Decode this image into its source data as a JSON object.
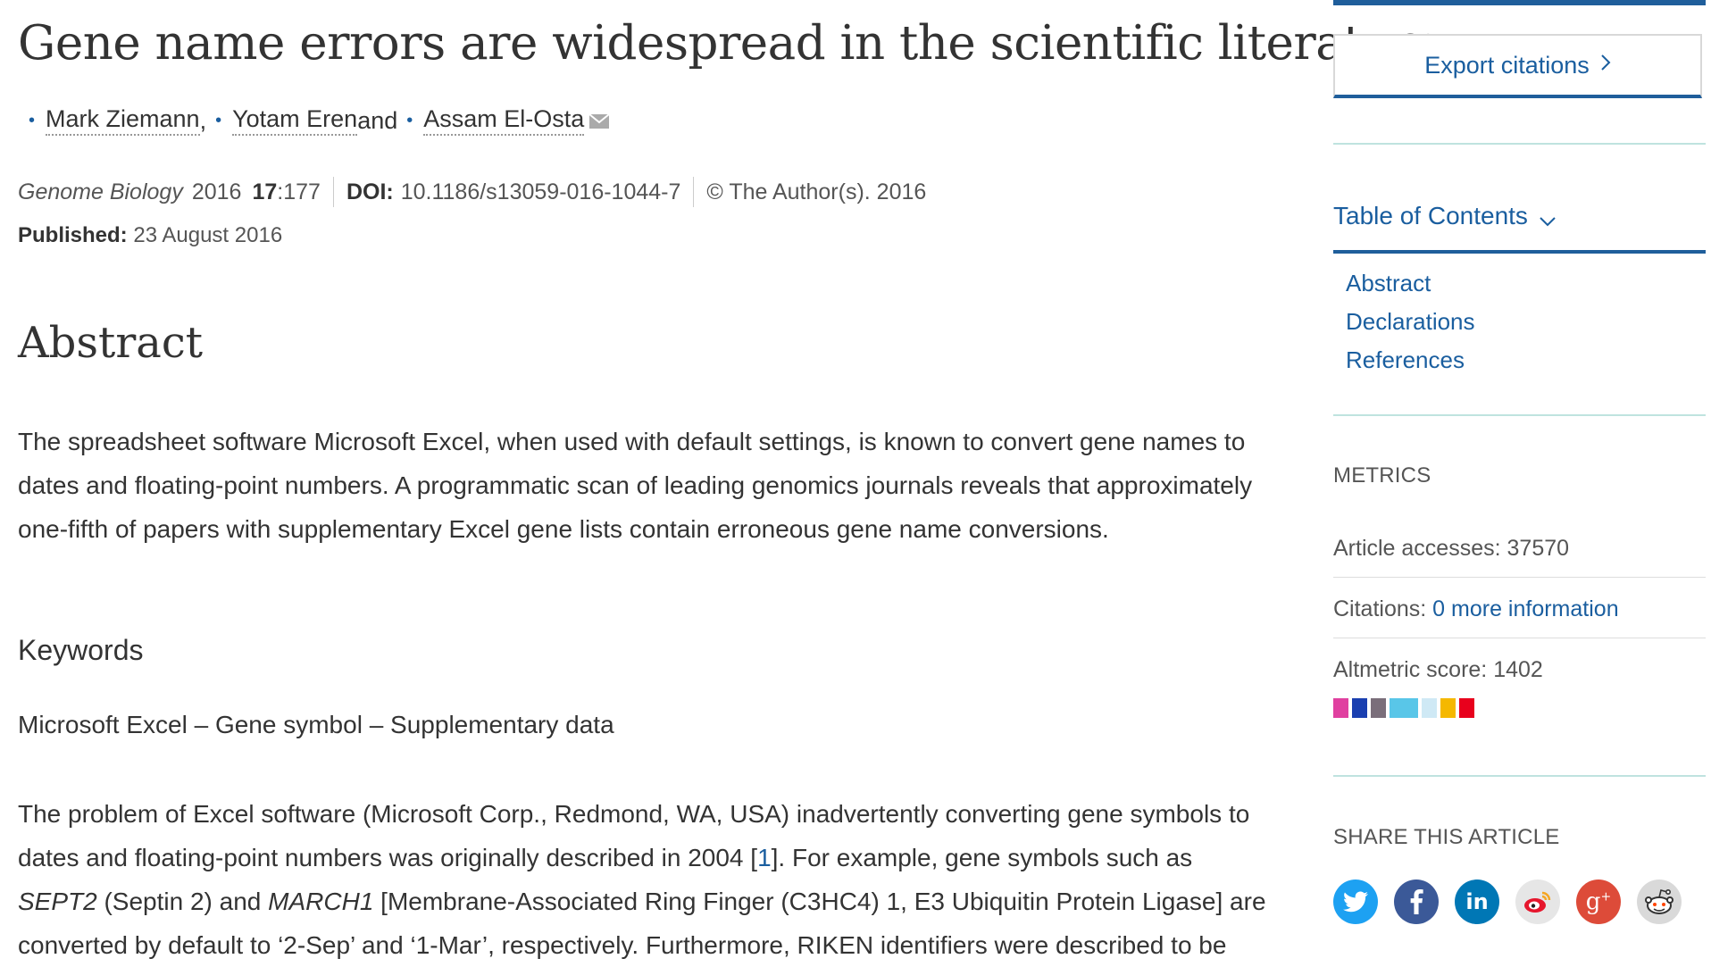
{
  "article": {
    "title": "Gene name errors are widespread in the scientific literature",
    "authors": [
      {
        "name": "Mark Ziemann",
        "sep": ","
      },
      {
        "name": "Yotam Eren",
        "sep": " and"
      },
      {
        "name": "Assam El-Osta",
        "sep": ""
      }
    ],
    "journal": "Genome Biology",
    "year": "2016",
    "volume": "17",
    "article_number": ":177",
    "doi_label": "DOI:",
    "doi": "10.1186/s13059-016-1044-7",
    "copyright": "© The Author(s). 2016",
    "published_label": "Published:",
    "published_date": "23 August 2016"
  },
  "abstract": {
    "heading": "Abstract",
    "text": "The spreadsheet software Microsoft Excel, when used with default settings, is known to convert gene names to dates and floating-point numbers. A programmatic scan of leading genomics journals reveals that approximately one-fifth of papers with supplementary Excel gene lists contain erroneous gene name conversions."
  },
  "keywords": {
    "heading": "Keywords",
    "text": "Microsoft Excel – Gene symbol – Supplementary data"
  },
  "body": {
    "p1_a": "The problem of Excel software (Microsoft Corp., Redmond, WA, USA) inadvertently converting gene symbols to dates and floating-point numbers was originally described in 2004 [",
    "p1_ref": "1",
    "p1_b": "]. For example, gene symbols such as ",
    "p1_gene1": "SEPT2",
    "p1_c": " (Septin 2) and ",
    "p1_gene2": "MARCH1",
    "p1_d": " [Membrane-Associated Ring Finger (C3HC4) 1, E3 Ubiquitin Protein Ligase] are converted by default to ‘2-Sep’ and ‘1-Mar’, respectively. Furthermore, RIKEN identifiers were described to be"
  },
  "sidebar": {
    "export_label": "Export citations",
    "toc_label": "Table of Contents",
    "toc_items": [
      "Abstract",
      "Declarations",
      "References"
    ],
    "metrics_title": "METRICS",
    "accesses_label": "Article accesses: 37570",
    "citations_label": "Citations: ",
    "citations_value": "0",
    "citations_more": " more information",
    "altmetric_label": "Altmetric score: 1402",
    "altmetric_colors": [
      "#e040a0",
      "#1a3fb0",
      "#7a6e7a",
      "#59c6e8",
      "#cfe9f5",
      "#f5b800",
      "#e8001c"
    ],
    "share_title": "SHARE THIS ARTICLE",
    "share_icons": [
      {
        "name": "twitter-icon",
        "color": "#1da1f2"
      },
      {
        "name": "facebook-icon",
        "color": "#3b5998"
      },
      {
        "name": "linkedin-icon",
        "color": "#0077b5"
      },
      {
        "name": "weibo-icon",
        "color": "#e6e6e6"
      },
      {
        "name": "google-plus-icon",
        "color": "#dd4b39"
      },
      {
        "name": "reddit-icon",
        "color": "#d9d9d9"
      }
    ]
  }
}
